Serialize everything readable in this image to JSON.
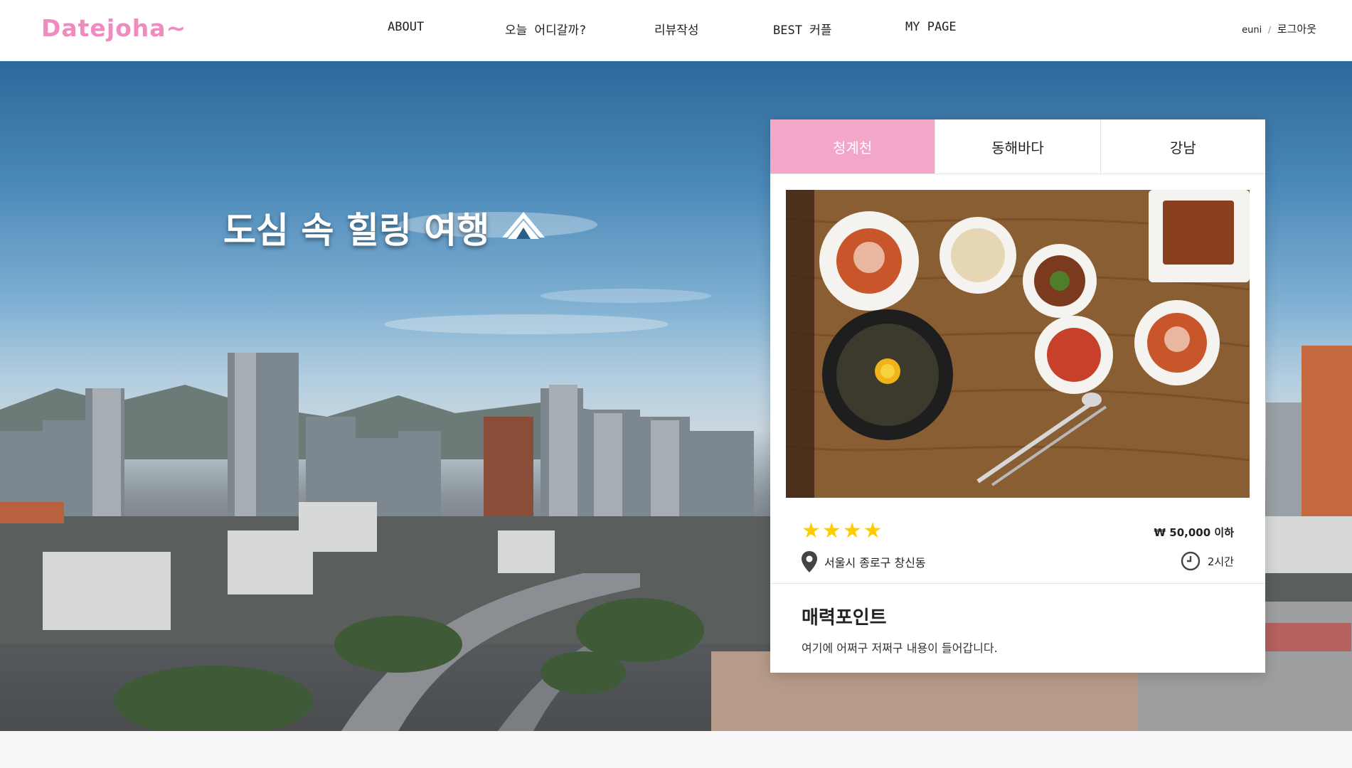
{
  "header": {
    "logo": "Datejoha~",
    "nav": [
      "ABOUT",
      "오늘 어디갈까?",
      "리뷰작성",
      "BEST 커플",
      "MY PAGE"
    ],
    "account": {
      "user": "euni",
      "separator": "/",
      "logout": "로그아웃"
    }
  },
  "hero": {
    "headline": "도심 속 힐링 여행",
    "headline_icon": "tent-icon"
  },
  "card": {
    "tabs": [
      {
        "label": "청계천",
        "active": true
      },
      {
        "label": "동해바다",
        "active": false
      },
      {
        "label": "강남",
        "active": false
      }
    ],
    "image_icon": "korean-food-photo",
    "rating": 4,
    "rating_stars": "★★★★",
    "price": "₩ 50,000 이하",
    "location": "서울시 종로구 창신동",
    "duration": "2시간",
    "section_title": "매력포인트",
    "section_text": "여기에 어쩌구 저쩌구 내용이 들어갑니다."
  },
  "colors": {
    "brand_pink": "#f08bc0",
    "active_tab": "#f2a6c8",
    "star": "#ffcc00"
  }
}
